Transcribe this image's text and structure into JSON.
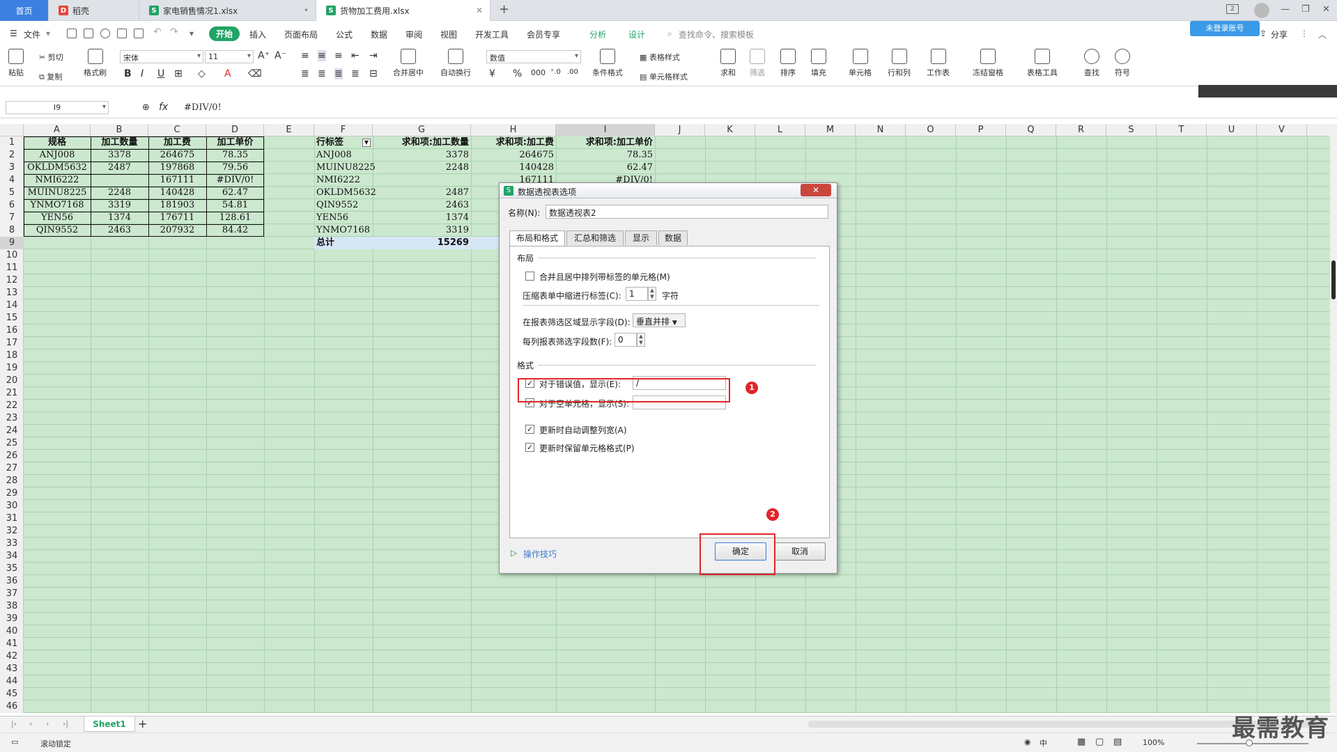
{
  "tabs": [
    {
      "label": "首页"
    },
    {
      "label": "稻壳"
    },
    {
      "label": "家电销售情况1.xlsx"
    },
    {
      "label": "货物加工费用.xlsx"
    }
  ],
  "titlebar": {
    "add_tab": "+",
    "badge": "2",
    "login_btn": "未登录账号"
  },
  "menu": {
    "file": "文件",
    "start": "开始",
    "items": [
      "插入",
      "页面布局",
      "公式",
      "数据",
      "审阅",
      "视图",
      "开发工具",
      "会员专享"
    ],
    "analyze": "分析",
    "design": "设计",
    "search_placeholder": "查找命令、搜索模板",
    "share": "分享"
  },
  "ribbon": {
    "paste": "粘贴",
    "cut": "剪切",
    "copy": "复制",
    "format_painter": "格式刷",
    "font_name": "宋体",
    "font_size": "11",
    "merge_center": "合并居中",
    "wrap": "自动换行",
    "number_format": "数值",
    "cond_format": "条件格式",
    "table_style": "表格样式",
    "cell_style": "单元格样式",
    "sum": "求和",
    "filter": "筛选",
    "sort": "排序",
    "fill": "填充",
    "cell": "单元格",
    "row_col": "行和列",
    "worksheet": "工作表",
    "freeze": "冻结窗格",
    "table_tools": "表格工具",
    "find": "查找",
    "symbol": "符号"
  },
  "formula_bar": {
    "name_box": "I9",
    "fx": "fx",
    "value": "#DIV/0!"
  },
  "columns": [
    "A",
    "B",
    "C",
    "D",
    "E",
    "F",
    "G",
    "H",
    "I",
    "J",
    "K",
    "L",
    "M",
    "N",
    "O",
    "P",
    "Q",
    "R",
    "S",
    "T",
    "U",
    "V"
  ],
  "rows": [
    "1",
    "2",
    "3",
    "4",
    "5",
    "6",
    "7",
    "8",
    "9",
    "10",
    "11",
    "12",
    "13",
    "14",
    "15",
    "16",
    "17",
    "18",
    "19",
    "20",
    "21",
    "22",
    "23",
    "24",
    "25",
    "26",
    "27",
    "28",
    "29",
    "30",
    "31",
    "32",
    "33",
    "34",
    "35",
    "36",
    "37",
    "38",
    "39",
    "40",
    "41",
    "42",
    "43",
    "44",
    "45",
    "46"
  ],
  "source_table": {
    "headers": [
      "规格",
      "加工数量",
      "加工费",
      "加工单价"
    ],
    "rows": [
      [
        "ANJ008",
        "3378",
        "264675",
        "78.35"
      ],
      [
        "OKLDM5632",
        "2487",
        "197868",
        "79.56"
      ],
      [
        "NMI6222",
        "",
        "167111",
        "#DIV/0!"
      ],
      [
        "MUINU8225",
        "2248",
        "140428",
        "62.47"
      ],
      [
        "YNMO7168",
        "3319",
        "181903",
        "54.81"
      ],
      [
        "YEN56",
        "1374",
        "176711",
        "128.61"
      ],
      [
        "QIN9552",
        "2463",
        "207932",
        "84.42"
      ]
    ]
  },
  "pivot_table": {
    "headers": [
      "行标签",
      "求和项:加工数量",
      "求和项:加工费",
      "求和项:加工单价"
    ],
    "rows": [
      [
        "ANJ008",
        "3378",
        "264675",
        "78.35"
      ],
      [
        "MUINU8225",
        "2248",
        "140428",
        "62.47"
      ],
      [
        "NMI6222",
        "",
        "167111",
        "#DIV/0!"
      ],
      [
        "OKLDM5632",
        "2487",
        "",
        ""
      ],
      [
        "QIN9552",
        "2463",
        "",
        ""
      ],
      [
        "YEN56",
        "1374",
        "",
        ""
      ],
      [
        "YNMO7168",
        "3319",
        "",
        ""
      ]
    ],
    "total_label": "总计",
    "total_value": "15269"
  },
  "dialog": {
    "title": "数据透视表选项",
    "name_label": "名称(N):",
    "name_value": "数据透视表2",
    "tabs": [
      "布局和格式",
      "汇总和筛选",
      "显示",
      "数据"
    ],
    "layout_section": "布局",
    "merge_center_label": "合并且居中排列带标签的单元格(M)",
    "indent_label": "压缩表单中缩进行标签(C):",
    "indent_value": "1",
    "indent_unit": "字符",
    "filter_area_label": "在报表筛选区域显示字段(D):",
    "filter_area_value": "垂直并排",
    "filter_count_label": "每列报表筛选字段数(F):",
    "filter_count_value": "0",
    "format_section": "格式",
    "error_label": "对于错误值，显示(E):",
    "error_value": "/",
    "empty_label": "对于空单元格，显示(S):",
    "empty_value": "",
    "autofit_label": "更新时自动调整列宽(A)",
    "preserve_label": "更新时保留单元格格式(P)",
    "tips": "操作技巧",
    "ok": "确定",
    "cancel": "取消",
    "marker1": "1",
    "marker2": "2"
  },
  "sheet_tabs": {
    "active": "Sheet1",
    "add": "+"
  },
  "status": {
    "scroll_lock": "滚动锁定",
    "zoom": "100%",
    "input_mode": "中"
  },
  "watermark": "最需教育"
}
